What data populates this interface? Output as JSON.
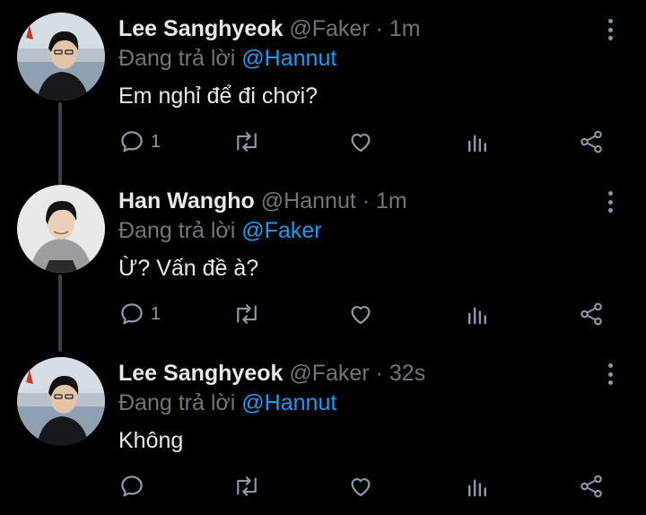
{
  "tweets": [
    {
      "name": "Lee Sanghyeok",
      "handle": "@Faker",
      "dot": "·",
      "time": "1m",
      "reply_prefix": "Đang trả lời",
      "reply_to": "@Hannut",
      "text": "Em nghỉ để đi chơi?",
      "reply_count": "1",
      "avatar": "dark-hair-portrait"
    },
    {
      "name": "Han Wangho",
      "handle": "@Hannut",
      "dot": "·",
      "time": "1m",
      "reply_prefix": "Đang trả lời",
      "reply_to": "@Faker",
      "text": "Ừ? Vấn đề à?",
      "reply_count": "1",
      "avatar": "grey-hoodie-portrait"
    },
    {
      "name": "Lee Sanghyeok",
      "handle": "@Faker",
      "dot": "·",
      "time": "32s",
      "reply_prefix": "Đang trả lời",
      "reply_to": "@Hannut",
      "text": "Không",
      "reply_count": "",
      "avatar": "dark-hair-portrait"
    }
  ],
  "icons": [
    "reply-icon",
    "retweet-icon",
    "like-icon",
    "analytics-icon",
    "share-icon",
    "more-icon"
  ],
  "colors": {
    "background": "#000000",
    "text": "#e7e9ea",
    "muted": "#6e767d",
    "accent": "#1d9bf0"
  }
}
